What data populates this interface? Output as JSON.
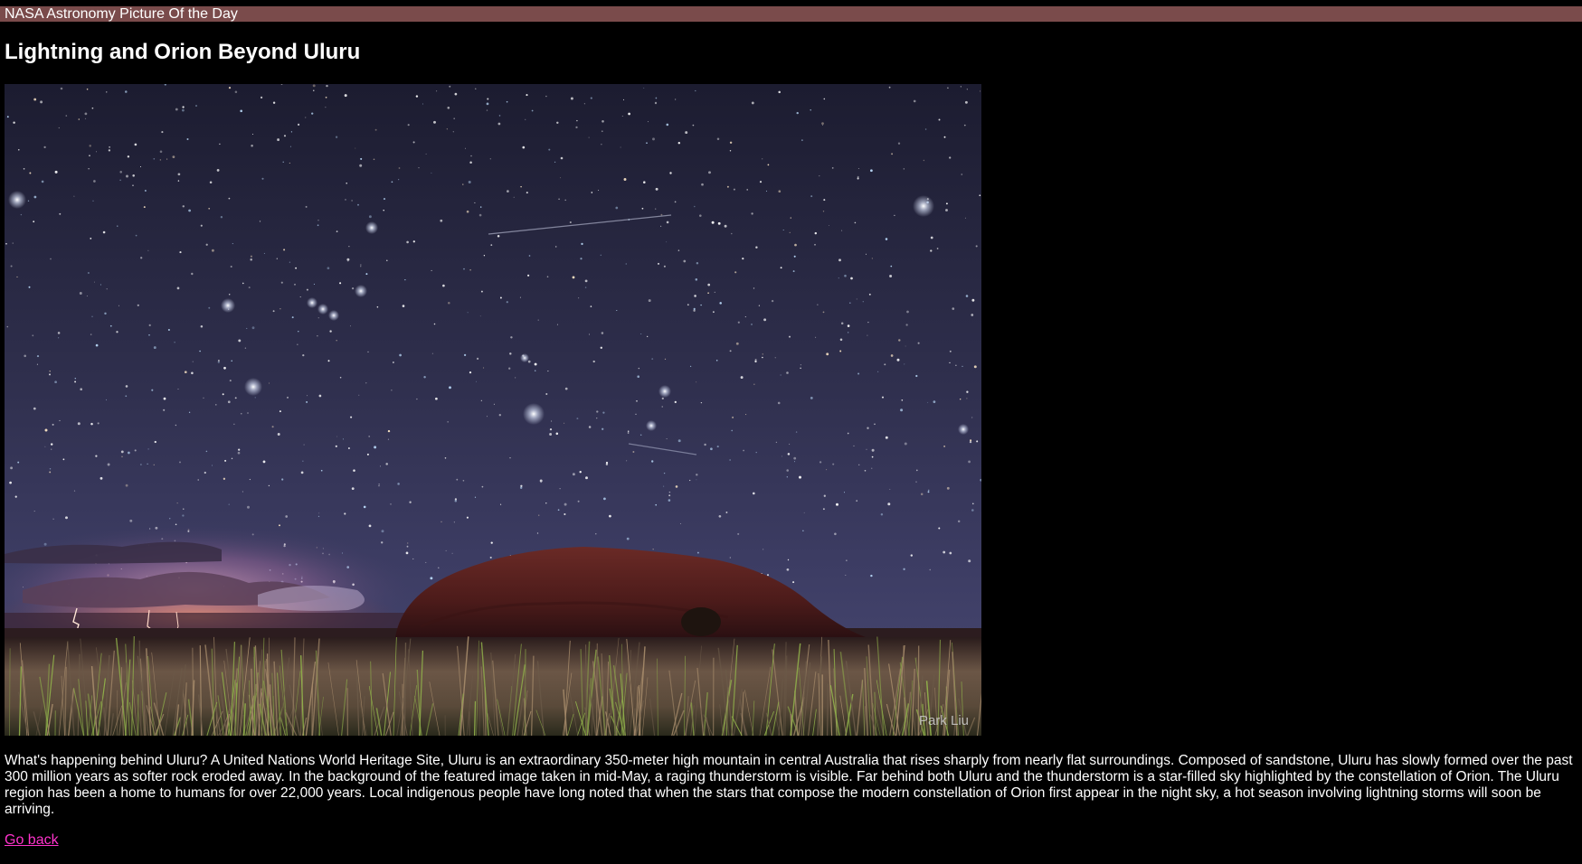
{
  "header": {
    "site_title": "NASA Astronomy Picture Of the Day"
  },
  "article": {
    "title": "Lightning and Orion Beyond Uluru",
    "image": {
      "credit": "Park Liu"
    },
    "description": "What's happening behind Uluru? A United Nations World Heritage Site, Uluru is an extraordinary 350-meter high mountain in central Australia that rises sharply from nearly flat surroundings. Composed of sandstone, Uluru has slowly formed over the past 300 million years as softer rock eroded away. In the background of the featured image taken in mid-May, a raging thunderstorm is visible. Far behind both Uluru and the thunderstorm is a star-filled sky highlighted by the constellation of Orion. The Uluru region has been a home to humans for over 22,000 years. Local indigenous people have long noted that when the stars that compose the modern constellation of Orion first appear in the night sky, a hot season involving lightning storms will soon be arriving.",
    "back_link": "Go back"
  },
  "colors": {
    "header_bar": "#7a4b4b",
    "background": "#000000",
    "link": "#ff33cc"
  }
}
